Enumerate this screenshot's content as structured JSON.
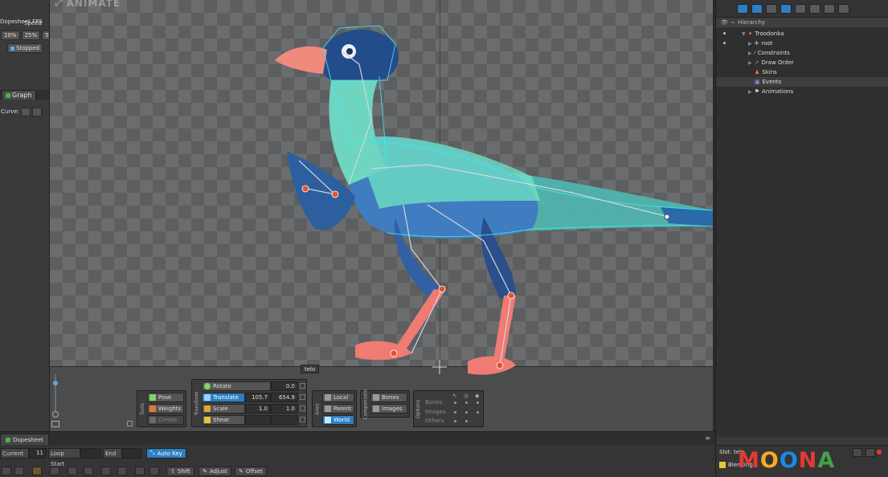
{
  "app": {
    "logo": "ANIMATE"
  },
  "left_panel": {
    "dopesheet_fps_label": "Dopesheet FPS",
    "speed_label": "Speed",
    "speed_options": [
      "10%",
      "25%",
      "5"
    ],
    "playback_state": "Stopped",
    "graph_tab": "Graph",
    "curve_label": "Curve:"
  },
  "viewport": {
    "selected_bone": "telo"
  },
  "tools": {
    "tools_group_label": "Tools",
    "pose": "Pose",
    "weights": "Weights",
    "create": "Create",
    "transform_group_label": "Transform",
    "rotate": "Rotate",
    "rotate_value": "0.0",
    "translate": "Translate",
    "translate_x": "105.7",
    "translate_y": "654.9",
    "scale": "Scale",
    "scale_x": "1.0",
    "scale_y": "1.0",
    "shear": "Shear",
    "axes_group_label": "Axes",
    "local": "Local",
    "parent": "Parent",
    "world": "World",
    "compensate_group_label": "Compensate",
    "comp_bones": "Bones",
    "comp_images": "Images",
    "options_group_label": "Options",
    "opt_bones": "Bones",
    "opt_images": "Images",
    "opt_others": "Others"
  },
  "hierarchy": {
    "title": "Hierarchy",
    "items": [
      {
        "label": "Troodonka"
      },
      {
        "label": "root"
      },
      {
        "label": "Constraints"
      },
      {
        "label": "Draw Order"
      },
      {
        "label": "Skins"
      },
      {
        "label": "Events"
      },
      {
        "label": "Animations"
      }
    ],
    "slot_label": "Slot: telo",
    "blending_label": "Blending"
  },
  "dopesheet": {
    "tab": "Dopesheet",
    "current_label": "Current",
    "current_value": "11",
    "loop_start_label": "Loop Start",
    "end_label": "End",
    "auto_key": "Auto Key",
    "shift": "Shift",
    "adjust": "Adjust",
    "offset": "Offset"
  },
  "watermark": {
    "letters": [
      "M",
      "O",
      "O",
      "N",
      "A"
    ],
    "colors": [
      "#e53935",
      "#f9a825",
      "#1e88e5",
      "#e53935",
      "#43a047"
    ]
  }
}
